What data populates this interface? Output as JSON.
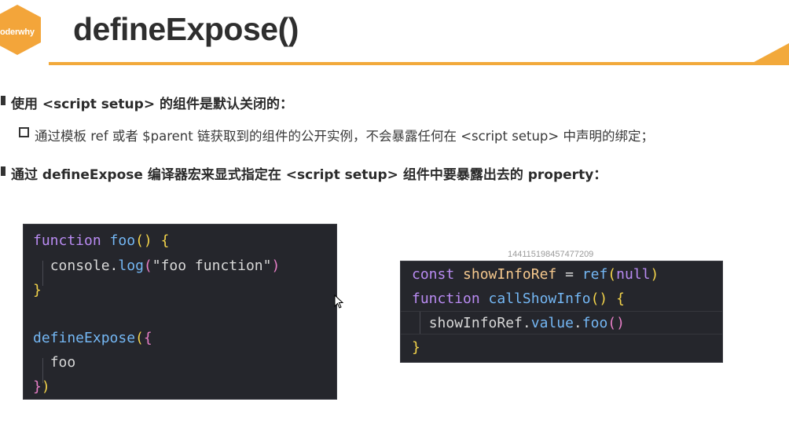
{
  "logo": {
    "text": "oderwhy"
  },
  "header": {
    "title": "defineExpose()"
  },
  "bullets": [
    "使用 <script setup> 的组件是默认关闭的：",
    "通过 defineExpose 编译器宏来显式指定在 <script setup> 组件中要暴露出去的 property："
  ],
  "sub_bullet": "通过模板 ref 或者 $parent 链获取到的组件的公开实例，不会暴露任何在 <script setup> 中声明的绑定；",
  "code_left": {
    "l1_kw": "function",
    "l1_fn": "foo",
    "l1_parens": "()",
    "l1_brace": "{",
    "l2_obj": "console.",
    "l2_fn": "log",
    "l2_open": "(",
    "l2_str": "\"foo function\"",
    "l2_close": ")",
    "l3_brace": "}",
    "l5_fn": "defineExpose",
    "l5_paren": "(",
    "l5_brace": "{",
    "l6_text": "foo",
    "l7_brace": "}",
    "l7_paren": ")"
  },
  "code_right": {
    "l1_kw": "const",
    "l1_var": "showInfoRef",
    "l1_eq": "=",
    "l1_fn": "ref",
    "l1_open": "(",
    "l1_null": "null",
    "l1_close": ")",
    "l2_kw": "function",
    "l2_fn": "callShowInfo",
    "l2_parens": "()",
    "l2_brace": "{",
    "l3_obj": "showInfoRef.",
    "l3_prop": "value",
    "l3_dot": ".",
    "l3_fn": "foo",
    "l3_parens": "()",
    "l4_brace": "}"
  },
  "watermark": "144115198457477209",
  "colors": {
    "accent": "#f2a93b",
    "code_bg": "#25262c"
  },
  "icons": {
    "cursor": "mouse-pointer-icon"
  }
}
